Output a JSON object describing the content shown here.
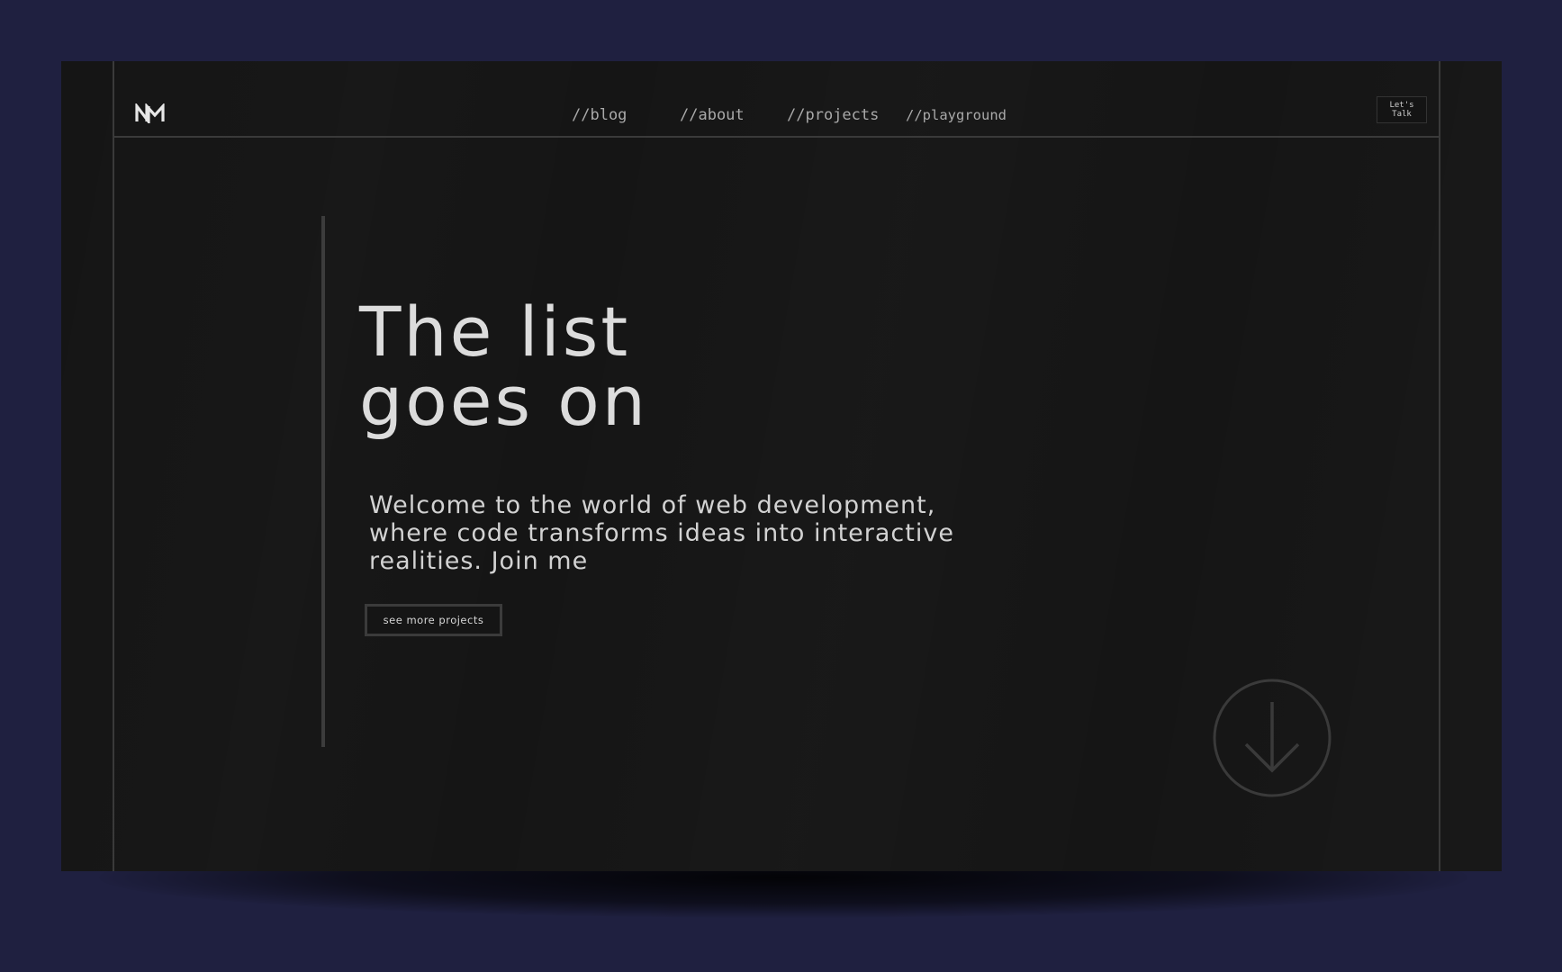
{
  "nav": {
    "items": [
      {
        "label": "//blog"
      },
      {
        "label": "//about"
      },
      {
        "label": "//projects"
      },
      {
        "label": "//playground"
      }
    ],
    "cta_label": "Let's Talk"
  },
  "hero": {
    "title_line1": "The list",
    "title_line2": "goes on",
    "intro": "Welcome to the world of web development, where code transforms ideas into interactive realities. Join me",
    "button_label": "see more projects"
  },
  "icons": {
    "logo": "nm-monogram-logo",
    "scroll": "arrow-down-circle-icon"
  },
  "colors": {
    "page_background": "#1f2040",
    "frame_background": "#151515",
    "line": "#3a3a3a",
    "text": "#dcdcdc"
  }
}
